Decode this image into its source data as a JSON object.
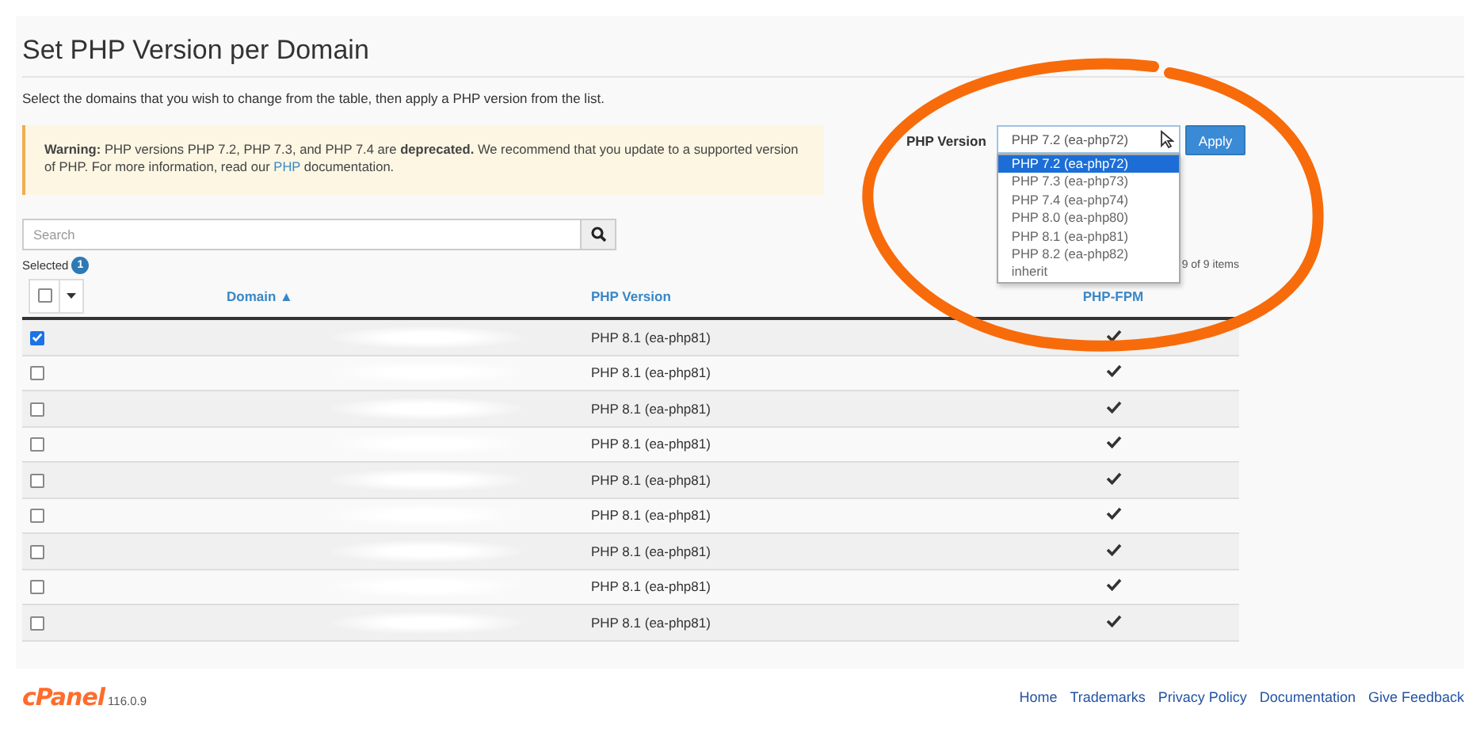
{
  "title": "Set PHP Version per Domain",
  "description": "Select the domains that you wish to change from the table, then apply a PHP version from the list.",
  "warning": {
    "text": "**Warning:** PHP versions PHP 7.2, PHP 7.3, and PHP 7.4 are **deprecated.** We recommend that you update to a supported version of PHP. For more information, read our ",
    "link": "PHP",
    "text_after": " documentation."
  },
  "php_version": {
    "label": "PHP Version",
    "value": "PHP 7.2 (ea-php72)",
    "expanded": true,
    "options": [
      {
        "label": "PHP 7.2 (ea-php72)",
        "selected": true
      },
      {
        "label": "PHP 7.3 (ea-php73)",
        "selected": false
      },
      {
        "label": "PHP 7.4 (ea-php74)",
        "selected": false
      },
      {
        "label": "PHP 8.0 (ea-php80)",
        "selected": false
      },
      {
        "label": "PHP 8.1 (ea-php81)",
        "selected": false
      },
      {
        "label": "PHP 8.2 (ea-php82)",
        "selected": false
      },
      {
        "label": "inherit",
        "selected": false
      }
    ],
    "apply": "Apply"
  },
  "search": {
    "placeholder": "Search"
  },
  "selected": {
    "label": "Selected",
    "count": "1"
  },
  "item_count": "9 of 9 items",
  "select_all": {
    "checked": false
  },
  "table": {
    "columns": [
      "Domain ▲",
      "PHP Version",
      "PHP-FPM"
    ],
    "rows": [
      {
        "checked": true,
        "php_version": "PHP 8.1 (ea-php81)",
        "fpm": true
      },
      {
        "checked": false,
        "php_version": "PHP 8.1 (ea-php81)",
        "fpm": true
      },
      {
        "checked": false,
        "php_version": "PHP 8.1 (ea-php81)",
        "fpm": true
      },
      {
        "checked": false,
        "php_version": "PHP 8.1 (ea-php81)",
        "fpm": true
      },
      {
        "checked": false,
        "php_version": "PHP 8.1 (ea-php81)",
        "fpm": true
      },
      {
        "checked": false,
        "php_version": "PHP 8.1 (ea-php81)",
        "fpm": true
      },
      {
        "checked": false,
        "php_version": "PHP 8.1 (ea-php81)",
        "fpm": true
      },
      {
        "checked": false,
        "php_version": "PHP 8.1 (ea-php81)",
        "fpm": true
      },
      {
        "checked": false,
        "php_version": "PHP 8.1 (ea-php81)",
        "fpm": true
      }
    ]
  },
  "footer": {
    "logo": "cPanel",
    "version": "116.0.9",
    "links": [
      "Home",
      "Trademarks",
      "Privacy Policy",
      "Documentation",
      "Give Feedback"
    ]
  }
}
